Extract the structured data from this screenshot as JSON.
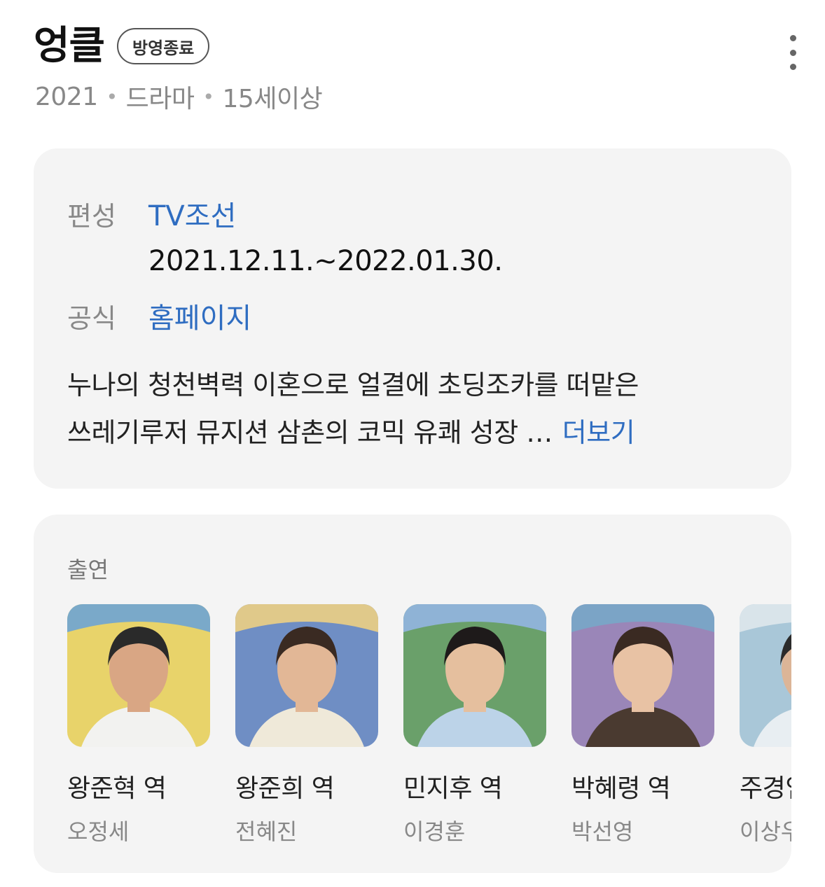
{
  "header": {
    "title": "엉클",
    "status": "방영종료",
    "meta": [
      "2021",
      "드라마",
      "15세이상"
    ],
    "more_icon": "kebab-menu-icon"
  },
  "info": {
    "network_label": "편성",
    "network": "TV조선",
    "period": "2021.12.11.~2022.01.30.",
    "official_label": "공식",
    "official": "홈페이지",
    "description_line1": "누나의 청천벽력 이혼으로 얼결에 초딩조카를 떠맡은",
    "description_line2": "쓰레기루저 뮤지션 삼촌의 코믹 유쾌 성장 …",
    "more_label": "더보기"
  },
  "cast": {
    "label": "출연",
    "items": [
      {
        "role": "왕준혁 역",
        "actor": "오정세",
        "colors": [
          "#e8d36a",
          "#7aa9c9",
          "#f2f2f0",
          "#2a2a2a",
          "#d9a684"
        ]
      },
      {
        "role": "왕준희 역",
        "actor": "전혜진",
        "colors": [
          "#6f8ec4",
          "#e0c98a",
          "#efe9d9",
          "#3a2a22",
          "#e2b796"
        ]
      },
      {
        "role": "민지후 역",
        "actor": "이경훈",
        "colors": [
          "#6aa06a",
          "#8fb3d6",
          "#bcd3e8",
          "#1e1a1a",
          "#e5bf9e"
        ]
      },
      {
        "role": "박혜령 역",
        "actor": "박선영",
        "colors": [
          "#9a86b8",
          "#7ba4c6",
          "#4a3a30",
          "#3a2a22",
          "#e8c2a4"
        ]
      },
      {
        "role": "주경임 역",
        "actor": "이상우",
        "colors": [
          "#a9c7d8",
          "#d9e4ea",
          "#e8eef2",
          "#2b2b2b",
          "#dcb597"
        ]
      }
    ]
  }
}
